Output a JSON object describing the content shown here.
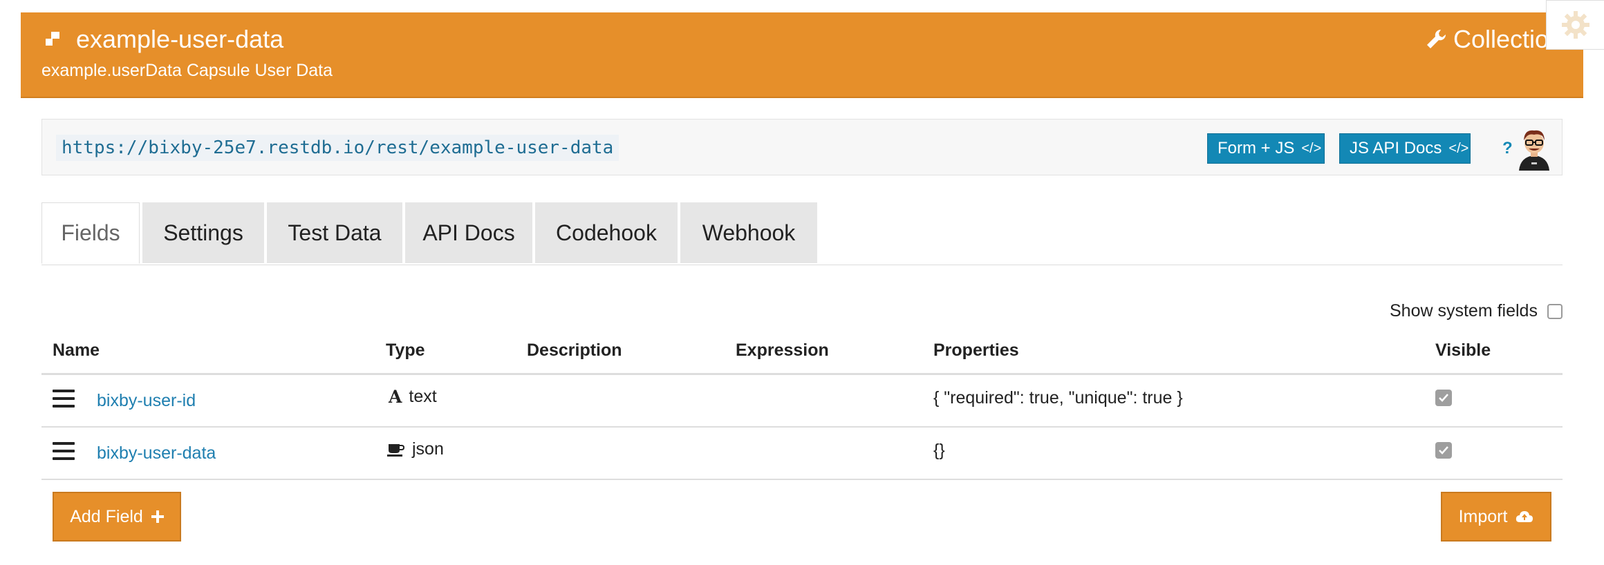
{
  "header": {
    "title": "example-user-data",
    "subtitle": "example.userData Capsule User Data",
    "collection_link": "Collectio"
  },
  "urlbar": {
    "url": "https://bixby-25e7.restdb.io/rest/example-user-data",
    "form_js_label": "Form + JS",
    "js_api_docs_label": "JS API Docs",
    "code_glyph": "</>",
    "help": "?"
  },
  "tabs": [
    {
      "label": "Fields",
      "active": true
    },
    {
      "label": "Settings"
    },
    {
      "label": "Test Data"
    },
    {
      "label": "API Docs"
    },
    {
      "label": "Codehook"
    },
    {
      "label": "Webhook"
    }
  ],
  "show_system_fields": {
    "label": "Show system fields",
    "checked": false
  },
  "table": {
    "columns": [
      "Name",
      "Type",
      "Description",
      "Expression",
      "Properties",
      "Visible"
    ],
    "rows": [
      {
        "name": "bixby-user-id",
        "type": "text",
        "type_icon": "text-icon",
        "type_glyph": "A",
        "description": "",
        "expression": "",
        "properties": "{ \"required\": true, \"unique\": true }",
        "visible": true
      },
      {
        "name": "bixby-user-data",
        "type": "json",
        "type_icon": "coffee-icon",
        "description": "",
        "expression": "",
        "properties": "{}",
        "visible": true
      }
    ]
  },
  "actions": {
    "add_field_label": "Add Field",
    "import_label": "Import"
  },
  "colors": {
    "brand_orange": "#e68f2a",
    "link_blue": "#1f7fb0",
    "button_blue": "#1388b5"
  }
}
